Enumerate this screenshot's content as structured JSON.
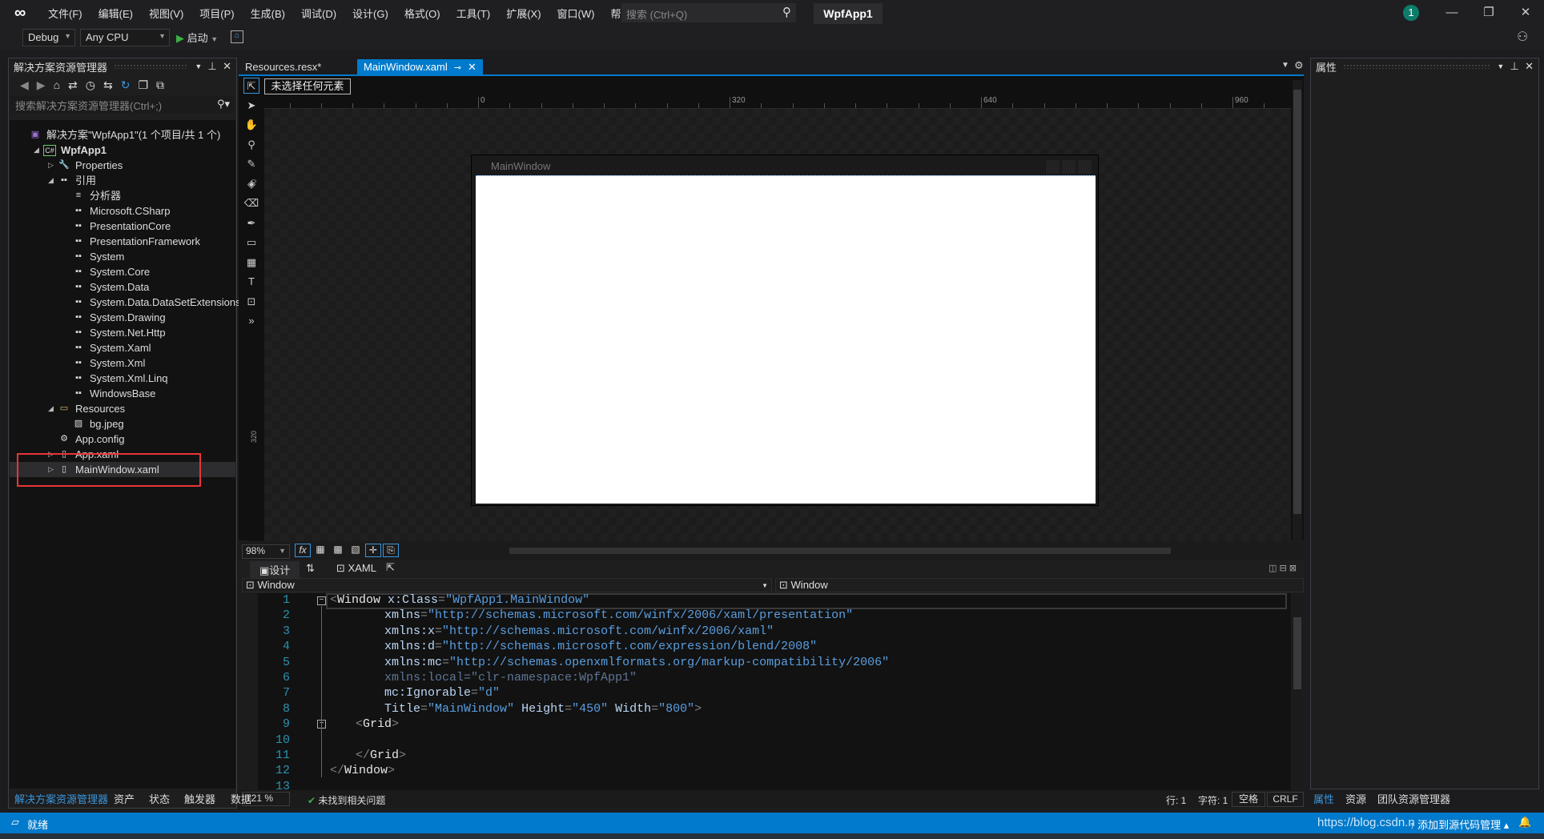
{
  "app": {
    "title": "WpfApp1",
    "notification_count": "1",
    "logo": "visual-studio-logo"
  },
  "menu": [
    "文件(F)",
    "编辑(E)",
    "视图(V)",
    "项目(P)",
    "生成(B)",
    "调试(D)",
    "设计(G)",
    "格式(O)",
    "工具(T)",
    "扩展(X)",
    "窗口(W)",
    "帮助(H)"
  ],
  "search": {
    "placeholder": "搜索 (Ctrl+Q)"
  },
  "toolbar": {
    "config": "Debug",
    "platform": "Any CPU",
    "start": "启动"
  },
  "solution_explorer": {
    "title": "解决方案资源管理器",
    "search_placeholder": "搜索解决方案资源管理器(Ctrl+;)",
    "items": [
      {
        "label": "解决方案\"WpfApp1\"(1 个项目/共 1 个)",
        "level": 0,
        "icon": "solution-icon"
      },
      {
        "label": "WpfApp1",
        "level": 1,
        "icon": "csharp-project-icon",
        "expanded": true,
        "bold": true
      },
      {
        "label": "Properties",
        "level": 2,
        "icon": "wrench-icon",
        "expanded": false
      },
      {
        "label": "引用",
        "level": 2,
        "icon": "reference-icon",
        "expanded": true
      },
      {
        "label": "分析器",
        "level": 3,
        "icon": "analyzer-icon"
      },
      {
        "label": "Microsoft.CSharp",
        "level": 3,
        "icon": "reference-icon"
      },
      {
        "label": "PresentationCore",
        "level": 3,
        "icon": "reference-icon"
      },
      {
        "label": "PresentationFramework",
        "level": 3,
        "icon": "reference-icon"
      },
      {
        "label": "System",
        "level": 3,
        "icon": "reference-icon"
      },
      {
        "label": "System.Core",
        "level": 3,
        "icon": "reference-icon"
      },
      {
        "label": "System.Data",
        "level": 3,
        "icon": "reference-icon"
      },
      {
        "label": "System.Data.DataSetExtensions",
        "level": 3,
        "icon": "reference-icon"
      },
      {
        "label": "System.Drawing",
        "level": 3,
        "icon": "reference-icon"
      },
      {
        "label": "System.Net.Http",
        "level": 3,
        "icon": "reference-icon"
      },
      {
        "label": "System.Xaml",
        "level": 3,
        "icon": "reference-icon"
      },
      {
        "label": "System.Xml",
        "level": 3,
        "icon": "reference-icon"
      },
      {
        "label": "System.Xml.Linq",
        "level": 3,
        "icon": "reference-icon"
      },
      {
        "label": "WindowsBase",
        "level": 3,
        "icon": "reference-icon"
      },
      {
        "label": "Resources",
        "level": 2,
        "icon": "folder-icon",
        "expanded": true
      },
      {
        "label": "bg.jpeg",
        "level": 3,
        "icon": "image-icon"
      },
      {
        "label": "App.config",
        "level": 2,
        "icon": "config-icon"
      },
      {
        "label": "App.xaml",
        "level": 2,
        "icon": "xaml-file-icon",
        "expanded": false
      },
      {
        "label": "MainWindow.xaml",
        "level": 2,
        "icon": "xaml-file-icon",
        "expanded": false,
        "selected": true
      }
    ],
    "bottom_tabs": [
      "解决方案资源管理器",
      "资产",
      "状态",
      "触发器",
      "数据"
    ]
  },
  "doc_tabs": [
    {
      "label": "Resources.resx*",
      "active": false
    },
    {
      "label": "MainWindow.xaml",
      "active": true
    }
  ],
  "designer": {
    "selection": "未选择任何元素",
    "ruler_top": [
      "0",
      "320",
      "640",
      "960"
    ],
    "ruler_left": [
      "0",
      "320"
    ],
    "window_title": "MainWindow",
    "zoom": "98%",
    "view_tabs": {
      "design": "设计",
      "swap": "⇅",
      "xaml": "XAML"
    }
  },
  "navbar": {
    "left": "Window",
    "right": "Window"
  },
  "code": [
    [
      [
        "t-p",
        "<"
      ],
      [
        "t-tag",
        "Window "
      ],
      [
        "t-attr",
        "x:Class"
      ],
      [
        "t-p",
        "="
      ],
      [
        "t-val",
        "\"WpfApp1.MainWindow\""
      ]
    ],
    [
      [
        "t-attr",
        "        xmlns"
      ],
      [
        "t-p",
        "="
      ],
      [
        "t-val",
        "\"http://schemas.microsoft.com/winfx/2006/xaml/presentation\""
      ]
    ],
    [
      [
        "t-attr",
        "        xmlns:x"
      ],
      [
        "t-p",
        "="
      ],
      [
        "t-val",
        "\"http://schemas.microsoft.com/winfx/2006/xaml\""
      ]
    ],
    [
      [
        "t-attr",
        "        xmlns:d"
      ],
      [
        "t-p",
        "="
      ],
      [
        "t-val",
        "\"http://schemas.microsoft.com/expression/blend/2008\""
      ]
    ],
    [
      [
        "t-attr",
        "        xmlns:mc"
      ],
      [
        "t-p",
        "="
      ],
      [
        "t-val",
        "\"http://schemas.openxmlformats.org/markup-compatibility/2006\""
      ]
    ],
    [
      [
        "t-dim",
        "        xmlns:local=\"clr-namespace:WpfApp1\""
      ]
    ],
    [
      [
        "t-attr",
        "        mc:Ignorable"
      ],
      [
        "t-p",
        "="
      ],
      [
        "t-val",
        "\"d\""
      ]
    ],
    [
      [
        "t-attr",
        "        Title"
      ],
      [
        "t-p",
        "="
      ],
      [
        "t-val",
        "\"MainWindow\""
      ],
      [
        "t-attr",
        " Height"
      ],
      [
        "t-p",
        "="
      ],
      [
        "t-val",
        "\"450\""
      ],
      [
        "t-attr",
        " Width"
      ],
      [
        "t-p",
        "="
      ],
      [
        "t-val",
        "\"800\""
      ],
      [
        "t-p",
        ">"
      ]
    ],
    [
      [
        "t-p",
        "    <"
      ],
      [
        "t-tag",
        "Grid"
      ],
      [
        "t-p",
        ">"
      ]
    ],
    [],
    [
      [
        "t-p",
        "    </"
      ],
      [
        "t-tag",
        "Grid"
      ],
      [
        "t-p",
        ">"
      ]
    ],
    [
      [
        "t-p",
        "</"
      ],
      [
        "t-tag",
        "Window"
      ],
      [
        "t-p",
        ">"
      ]
    ],
    []
  ],
  "editor_status": {
    "zoom": "121 %",
    "issues": "未找到相关问题",
    "line": "行: 1",
    "char": "字符: 1",
    "spaces": "空格",
    "eol": "CRLF"
  },
  "properties": {
    "title": "属性",
    "bottom_tabs": [
      "属性",
      "资源",
      "团队资源管理器"
    ]
  },
  "statusbar": {
    "ready": "就绪",
    "source_control": "添加到源代码管理",
    "watermark": "https://blog.csdn.n"
  },
  "colors": {
    "accent": "#007acc",
    "highlight_box": "#e8343a",
    "badge": "#0e7c6b"
  }
}
